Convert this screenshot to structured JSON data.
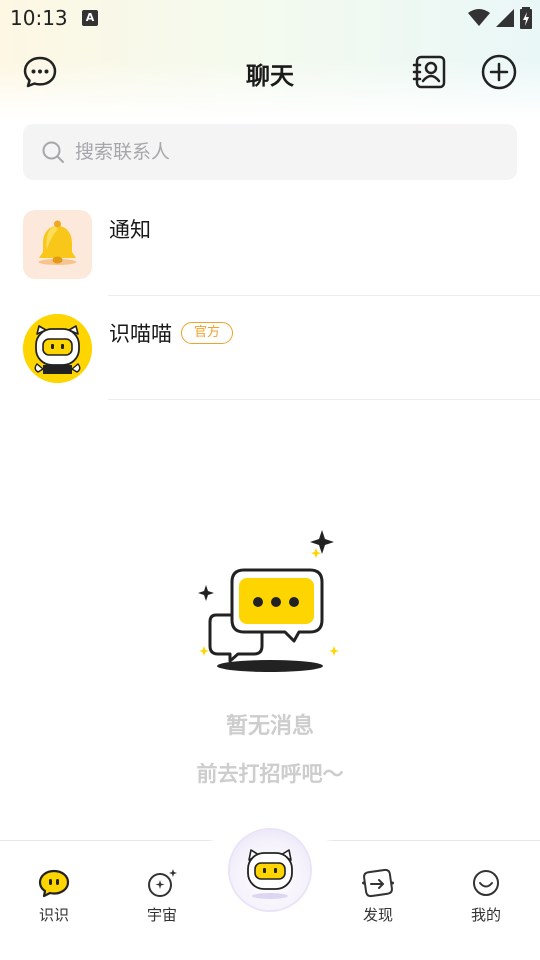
{
  "status_bar": {
    "time": "10:13",
    "notif_letter": "A"
  },
  "header": {
    "title": "聊天"
  },
  "search": {
    "placeholder": "搜索联系人"
  },
  "conversations": [
    {
      "name": "通知",
      "avatar": "bell-icon"
    },
    {
      "name": "识喵喵",
      "badge": "官方",
      "avatar": "mascot-avatar"
    }
  ],
  "empty_state": {
    "title": "暂无消息",
    "subtitle": "前去打招呼吧～"
  },
  "bottom_nav": [
    {
      "label": "识识",
      "icon": "chat-bubble-icon",
      "active": true
    },
    {
      "label": "宇宙",
      "icon": "planet-icon"
    },
    {
      "label": "",
      "icon": "mascot-center-icon"
    },
    {
      "label": "发现",
      "icon": "discover-icon"
    },
    {
      "label": "我的",
      "icon": "smile-icon"
    }
  ],
  "colors": {
    "accent": "#ffd500",
    "badge": "#f0a22b",
    "muted": "#cdcdcd"
  }
}
